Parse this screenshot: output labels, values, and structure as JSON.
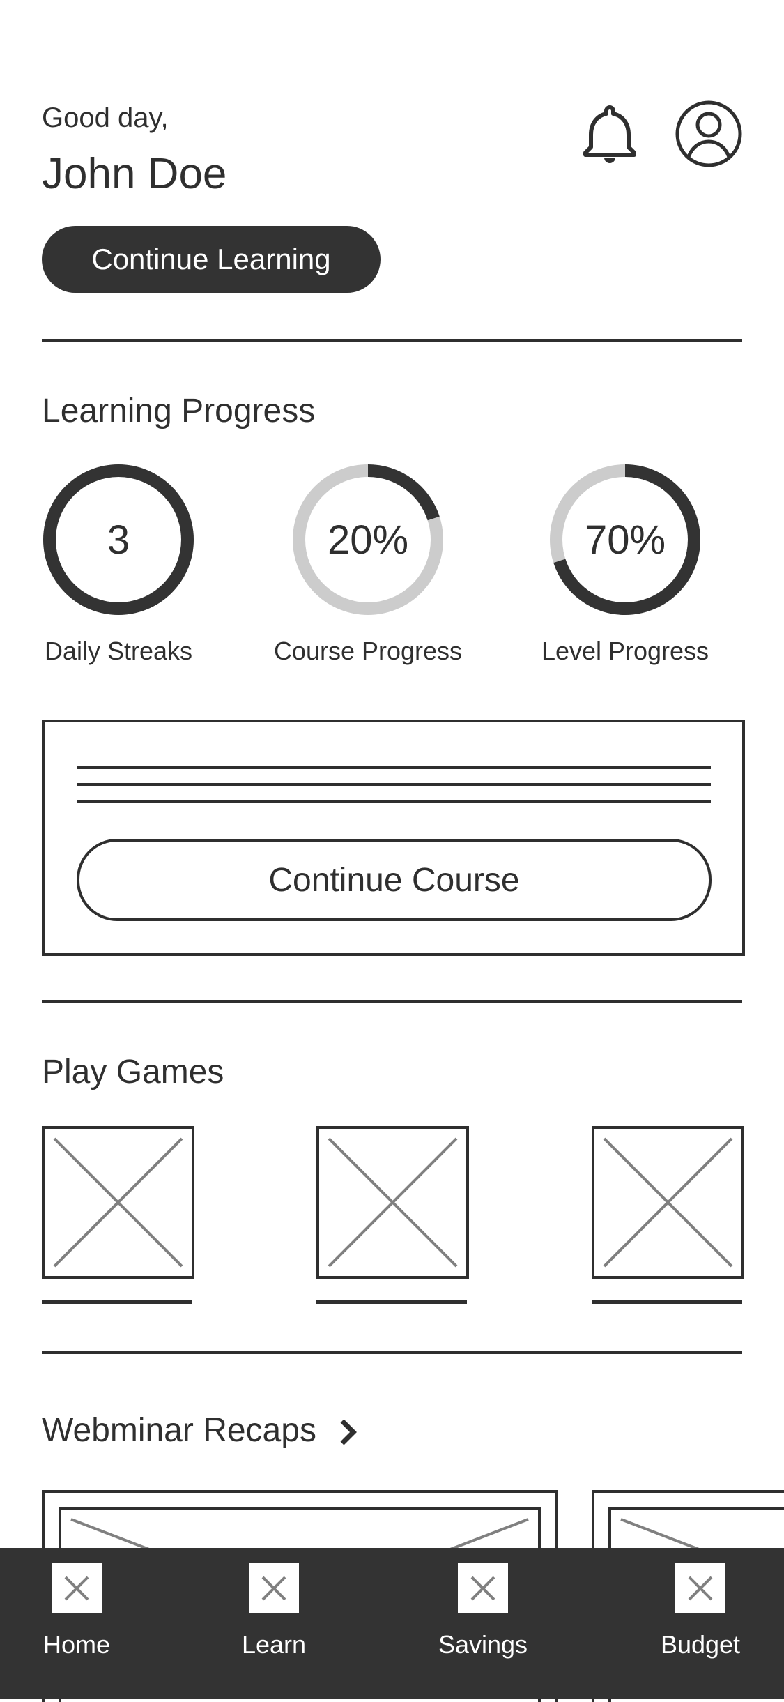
{
  "header": {
    "greeting": "Good day,",
    "user_name": "John Doe",
    "icons": [
      "bell-icon",
      "profile-icon"
    ]
  },
  "continue_learning_label": "Continue Learning",
  "learning_progress": {
    "title": "Learning Progress",
    "items": [
      {
        "value_text": "3",
        "label": "Daily Streaks",
        "fraction": 1.0
      },
      {
        "value_text": "20%",
        "label": "Course Progress",
        "fraction": 0.2
      },
      {
        "value_text": "70%",
        "label": "Level Progress",
        "fraction": 0.7
      }
    ]
  },
  "course_card": {
    "button_label": "Continue Course"
  },
  "play_games": {
    "title": "Play Games",
    "count": 3
  },
  "webinar_recaps": {
    "title": "Webminar Recaps"
  },
  "bottom_nav": {
    "items": [
      {
        "label": "Home"
      },
      {
        "label": "Learn"
      },
      {
        "label": "Savings"
      },
      {
        "label": "Budget"
      }
    ]
  },
  "colors": {
    "dark": "#333333",
    "text": "#2f2f2f",
    "track": "#cccccc",
    "background": "#ffffff"
  }
}
